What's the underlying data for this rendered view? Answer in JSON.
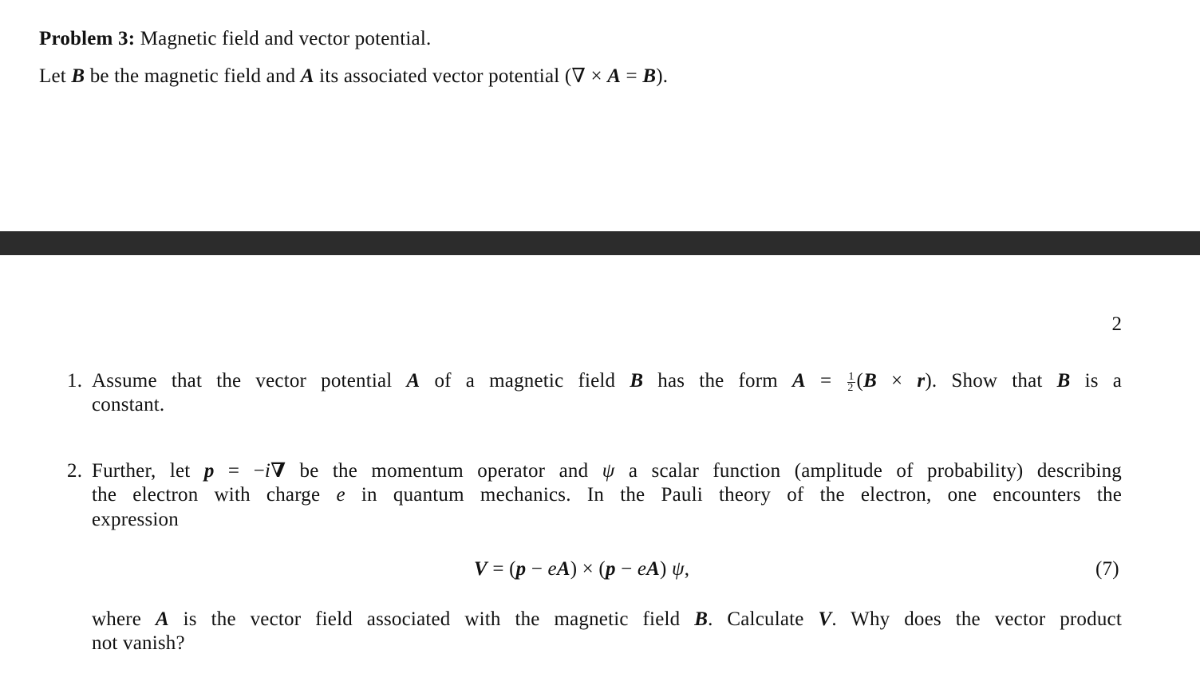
{
  "page1": {
    "problem_label": "Problem 3:",
    "problem_title": "Magnetic field and vector potential.",
    "intro": {
      "t1": "Let ",
      "B": "B",
      "t2": " be the magnetic field and ",
      "A": "A",
      "t3": " its associated vector potential (∇ × ",
      "A2": "A",
      "t4": " = ",
      "B2": "B",
      "t5": ")."
    }
  },
  "page2": {
    "page_number": "2",
    "item1": {
      "number": "1.",
      "t1": "Assume that the vector potential ",
      "A": "A",
      "t2": " of a magnetic field ",
      "B": "B",
      "t3": " has the form ",
      "A2": "A",
      "t4": " = ",
      "frac_num": "1",
      "frac_den": "2",
      "t5": "(",
      "B2": "B",
      "t6": " × ",
      "r": "r",
      "t7": ").  Show that ",
      "B3": "B",
      "t8": " is a",
      "line2": "constant."
    },
    "item2": {
      "number": "2.",
      "l1": {
        "t1": "Further, let ",
        "p": "p",
        "t2": " = −",
        "i": "i",
        "nabla": "∇",
        "t3": " be the momentum operator and ",
        "psi": "ψ",
        "t4": " a scalar function (amplitude of probability) describing"
      },
      "l2": {
        "t1": "the electron with charge ",
        "e": "e",
        "t2": " in quantum mechanics.  In the Pauli theory of the electron, one encounters the"
      },
      "l3": "expression",
      "equation": {
        "V": "V",
        "t1": " = (",
        "p1": "p",
        "t2": " − ",
        "e1": "e",
        "A1": "A",
        "t3": ") × (",
        "p2": "p",
        "t4": " − ",
        "e2": "e",
        "A2": "A",
        "t5": ") ",
        "psi": "ψ",
        "t6": ",",
        "number": "(7)"
      },
      "l4": {
        "t1": "where ",
        "A": "A",
        "t2": " is the vector field associated with the magnetic field ",
        "B": "B",
        "t3": ".  Calculate ",
        "V": "V",
        "t4": ".  Why does the vector product"
      },
      "l5": "not vanish?"
    }
  }
}
